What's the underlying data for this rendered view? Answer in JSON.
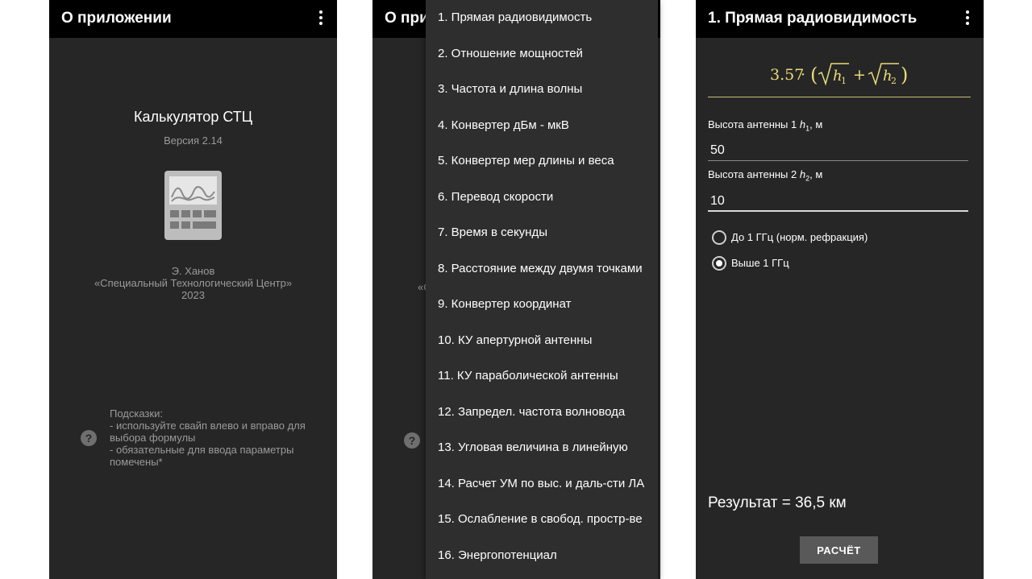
{
  "screen_about": {
    "title": "О приложении",
    "app_name": "Калькулятор СТЦ",
    "version": "Версия 2.14",
    "author_lines": [
      "Э. Ханов",
      "«Специальный Технологический Центр»",
      "2023"
    ],
    "hints_lines": [
      "Подсказки:",
      "- используйте свайп влево и вправо для",
      "выбора формулы",
      "- обязательные для ввода параметры",
      "помечены*"
    ],
    "icons": [
      "more-vert-icon",
      "calculator-app-icon",
      "help-icon"
    ]
  },
  "screen_menu": {
    "title_partial": "О при",
    "author_partial": "«С",
    "items": [
      "1. Прямая радиовидимость",
      "2. Отношение мощностей",
      "3. Частота и длина волны",
      "4. Конвертер дБм - мкВ",
      "5. Конвертер мер длины и веса",
      "6. Перевод скорости",
      "7. Время в секунды",
      "8. Расстояние между двумя точками",
      "9. Конвертер координат",
      "10. КУ апертурной антенны",
      "11. КУ параболической антенны",
      "12. Запредел. частота волновода",
      "13. Угловая величина в линейную",
      "14. Расчет УМ по выс. и даль-сти ЛА",
      "15. Ослабление в свобод. простр-ве",
      "16. Энергопотенциал"
    ]
  },
  "screen_calc": {
    "title": "1. Прямая радиовидимость",
    "formula": {
      "coef": "3.57",
      "dot": "·",
      "open": "(",
      "var1": "h",
      "sub1": "1",
      "plus": "+",
      "var2": "h",
      "sub2": "2",
      "close": ")"
    },
    "field1": {
      "label": "Высота антенны 1 ",
      "var": "h",
      "sub": "1",
      "suffix": ", м",
      "value": "50"
    },
    "field2": {
      "label": "Высота антенны 2 ",
      "var": "h",
      "sub": "2",
      "suffix": ", м",
      "value": "10"
    },
    "radio_options": [
      {
        "label": "До 1 ГГц (норм. рефракция)",
        "checked": false
      },
      {
        "label": "Выше 1 ГГц",
        "checked": true
      }
    ],
    "result": "Результат = 36,5 км",
    "button": "РАСЧЁТ"
  },
  "colors": {
    "background": "#262626",
    "appbar": "#000000",
    "formula": "#e8dc7a",
    "muted_text": "#9a9a9a",
    "menu_bg": "#2e2e2e",
    "button": "#595959"
  }
}
